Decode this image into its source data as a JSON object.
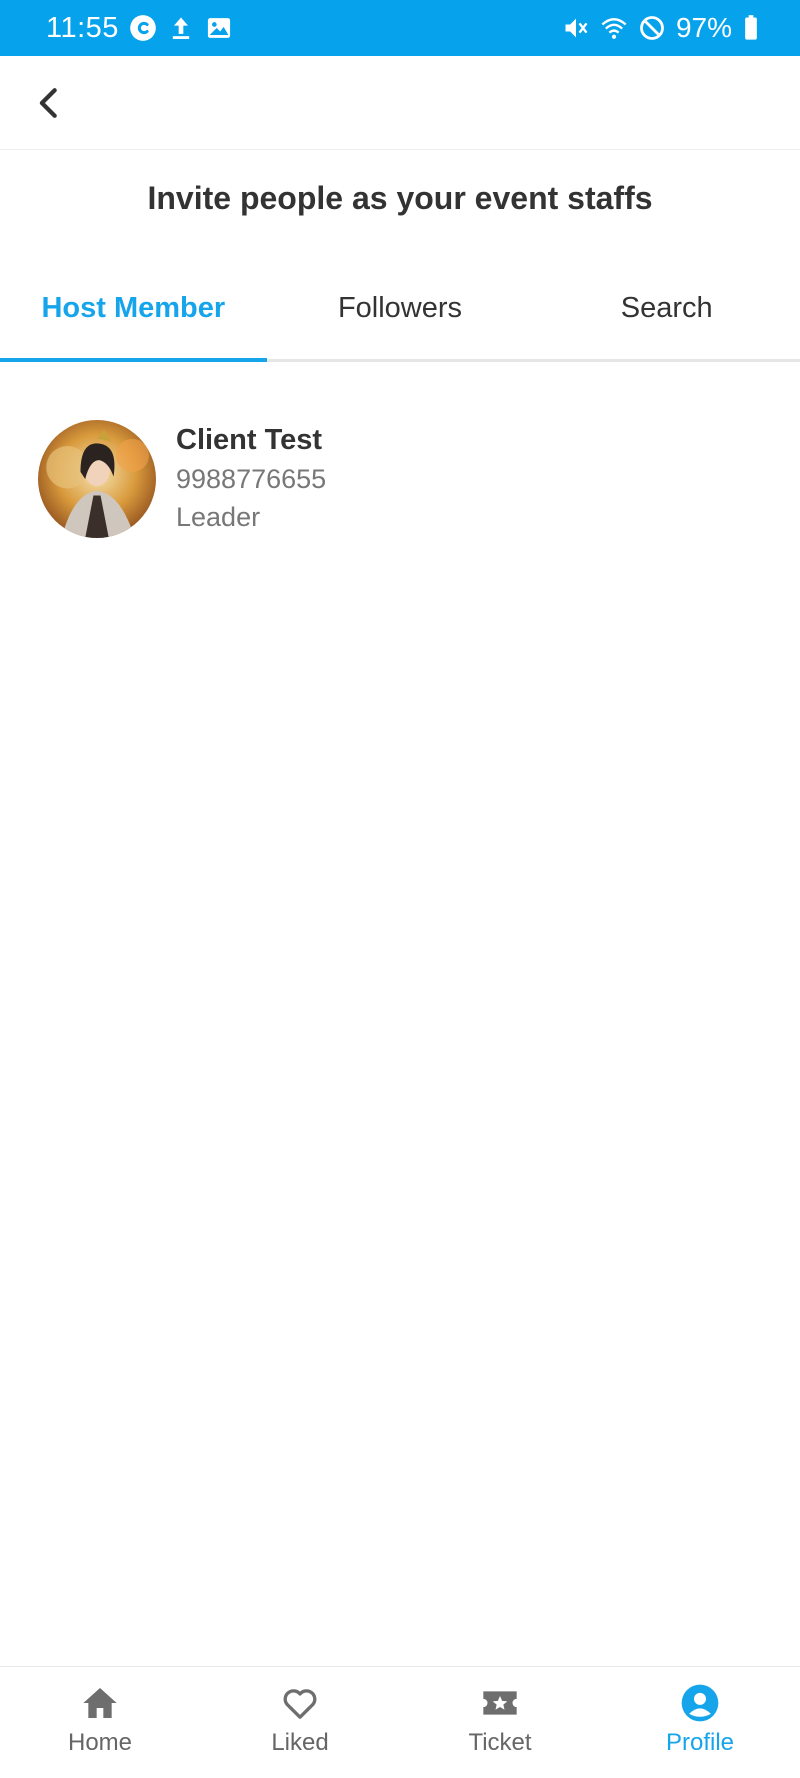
{
  "status_bar": {
    "time": "11:55",
    "battery": "97%",
    "left_icons": [
      "c-circle-icon",
      "upload-icon",
      "image-icon"
    ],
    "right_icons": [
      "mute-icon",
      "wifi-icon",
      "blocked-icon",
      "battery-icon"
    ]
  },
  "header": {
    "title": "Invite people as your event staffs"
  },
  "tabs": [
    {
      "label": "Host Member",
      "active": true
    },
    {
      "label": "Followers",
      "active": false
    },
    {
      "label": "Search",
      "active": false
    }
  ],
  "members": [
    {
      "name": "Client Test",
      "phone": "9988776655",
      "role": "Leader"
    }
  ],
  "bottom_nav": [
    {
      "label": "Home",
      "icon": "home-icon",
      "active": false
    },
    {
      "label": "Liked",
      "icon": "heart-icon",
      "active": false
    },
    {
      "label": "Ticket",
      "icon": "ticket-icon",
      "active": false
    },
    {
      "label": "Profile",
      "icon": "profile-icon",
      "active": true
    }
  ],
  "colors": {
    "status_bar": "#06a3ec",
    "accent": "#16a5ea",
    "text": "#333333",
    "muted": "#777777"
  }
}
